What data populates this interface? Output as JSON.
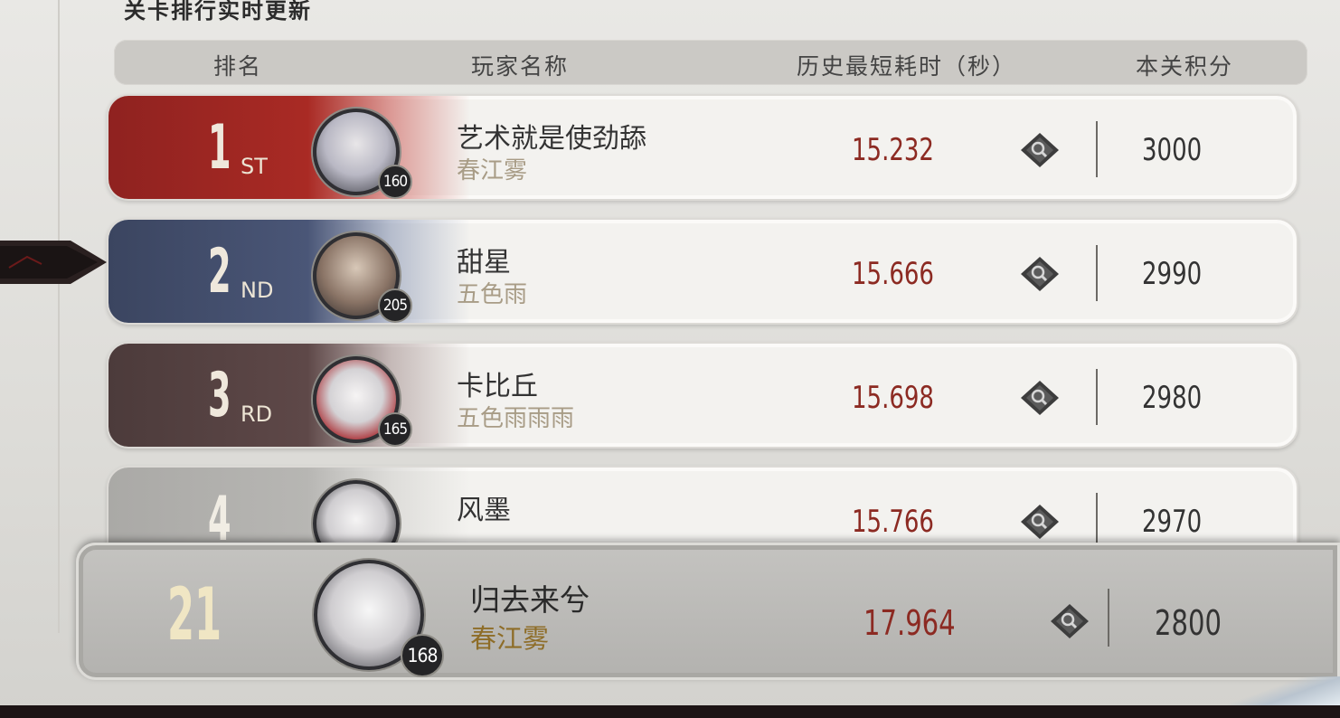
{
  "page_title": "关卡排行实时更新",
  "header": {
    "rank": "排名",
    "player": "玩家名称",
    "time": "历史最短耗时（秒）",
    "score": "本关积分"
  },
  "rows": [
    {
      "rank": "1",
      "suffix": "ST",
      "level": "160",
      "name": "艺术就是使劲舔",
      "guild": "春江雾",
      "time": "15.232",
      "score": "3000"
    },
    {
      "rank": "2",
      "suffix": "ND",
      "level": "205",
      "name": "甜星",
      "guild": "五色雨",
      "time": "15.666",
      "score": "2990"
    },
    {
      "rank": "3",
      "suffix": "RD",
      "level": "165",
      "name": "卡比丘",
      "guild": "五色雨雨雨",
      "time": "15.698",
      "score": "2980"
    },
    {
      "rank": "4",
      "suffix": "",
      "level": "",
      "name": "风墨",
      "guild": "",
      "time": "15.766",
      "score": "2970"
    }
  ],
  "self": {
    "rank": "21",
    "level": "168",
    "name": "归去来兮",
    "guild": "春江雾",
    "time": "17.964",
    "score": "2800"
  },
  "colors": {
    "first": "#a92a24",
    "second": "#4a5677",
    "third": "#5e4848",
    "time_text": "#8c2a22",
    "self_guild": "#8e6d28"
  },
  "icons": {
    "detail": "magnifier-diamond-icon",
    "pointer": "arrow-pointer-icon"
  }
}
